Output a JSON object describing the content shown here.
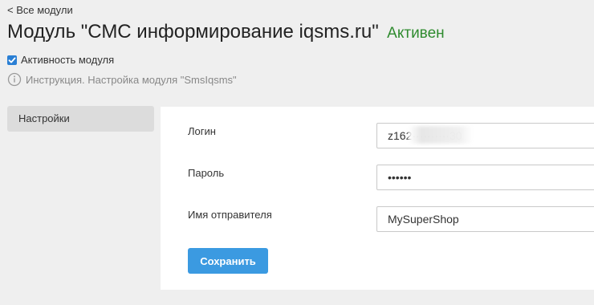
{
  "header": {
    "back_link": "< Все модули",
    "title": "Модуль \"СМС информирование iqsms.ru\"",
    "status": "Активен"
  },
  "module_active": {
    "label": "Активность модуля",
    "checked": true
  },
  "instruction": {
    "icon": "info-icon",
    "text": "Инструкция. Настройка модуля \"SmsIqsms\""
  },
  "sidebar": {
    "items": [
      {
        "label": "Настройки",
        "selected": true
      }
    ]
  },
  "form": {
    "login_label": "Логин",
    "login_value": "z162··········30",
    "password_label": "Пароль",
    "password_value": "••••••",
    "sender_label": "Имя отправителя",
    "sender_value": "MySuperShop",
    "save_label": "Сохранить"
  },
  "colors": {
    "status_green": "#2e8b2e",
    "accent_blue": "#3b9ae1",
    "checkbox_blue": "#2a7fd4",
    "page_background": "#efefef",
    "panel_background": "#ffffff"
  }
}
